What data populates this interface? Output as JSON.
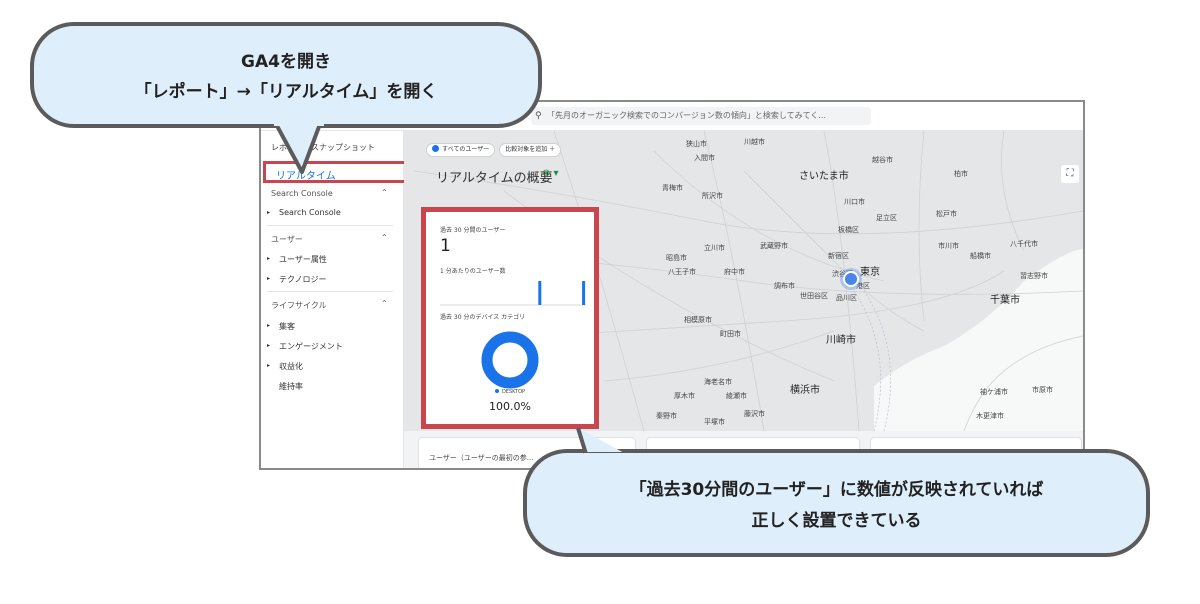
{
  "search": {
    "placeholder": "「先月のオーガニック検索でのコンバージョン数の傾向」と検索してみてく..."
  },
  "sidebar": {
    "snapshot_label": "レポートのスナップショット",
    "realtime_label": "リアルタイム",
    "sections": [
      {
        "title": "Search Console",
        "items": [
          "Search Console"
        ]
      },
      {
        "title": "ユーザー",
        "items": [
          "ユーザー属性",
          "テクノロジー"
        ]
      },
      {
        "title": "ライフサイクル",
        "items": [
          "集客",
          "エンゲージメント",
          "収益化",
          "維持率"
        ]
      }
    ]
  },
  "toolbar": {
    "all_users_chip": "すべてのユーザー",
    "add_compare_chip": "比較対象を追加 ＋"
  },
  "page": {
    "title": "リアルタイムの概要"
  },
  "card": {
    "users_label": "過去 30 分間のユーザー",
    "users_value": "1",
    "per_minute_label": "1 分あたりのユーザー数",
    "device_label": "過去 30 分のデバイス カテゴリ",
    "device_legend": "DESKTOP",
    "device_percent": "100.0%",
    "per_minute_bars": [
      0,
      0,
      0,
      0,
      0,
      0,
      0,
      0,
      0,
      0,
      0,
      0,
      0,
      0,
      0,
      0,
      0,
      0,
      0,
      0,
      1,
      0,
      0,
      0,
      0,
      0,
      0,
      0,
      0,
      1
    ]
  },
  "bottom": {
    "users_label": "ユーザー（ユーザーの最初の参..."
  },
  "map_places": [
    {
      "name": "川越市",
      "big": false
    },
    {
      "name": "越谷市",
      "big": false
    },
    {
      "name": "さいたま市",
      "big": true
    },
    {
      "name": "柏市",
      "big": false
    },
    {
      "name": "川口市",
      "big": false
    },
    {
      "name": "足立区",
      "big": false
    },
    {
      "name": "松戸市",
      "big": false
    },
    {
      "name": "板橋区",
      "big": false
    },
    {
      "name": "市川市",
      "big": false
    },
    {
      "name": "船橋市",
      "big": false
    },
    {
      "name": "八千代市",
      "big": false
    },
    {
      "name": "新宿区",
      "big": false
    },
    {
      "name": "東京",
      "big": true
    },
    {
      "name": "渋谷区",
      "big": false
    },
    {
      "name": "港区",
      "big": false
    },
    {
      "name": "世田谷区",
      "big": false
    },
    {
      "name": "品川区",
      "big": false
    },
    {
      "name": "千葉市",
      "big": true
    },
    {
      "name": "八王子市",
      "big": false
    },
    {
      "name": "府中市",
      "big": false
    },
    {
      "name": "武蔵野市",
      "big": false
    },
    {
      "name": "立川市",
      "big": false
    },
    {
      "name": "昭島市",
      "big": false
    },
    {
      "name": "調布市",
      "big": false
    },
    {
      "name": "相模原市",
      "big": false
    },
    {
      "name": "町田市",
      "big": false
    },
    {
      "name": "川崎市",
      "big": true
    },
    {
      "name": "横浜市",
      "big": true
    },
    {
      "name": "青梅市",
      "big": false
    },
    {
      "name": "入間市",
      "big": false
    },
    {
      "name": "所沢市",
      "big": false
    },
    {
      "name": "狭山市",
      "big": false
    },
    {
      "name": "海老名市",
      "big": false
    },
    {
      "name": "厚木市",
      "big": false
    },
    {
      "name": "綾瀬市",
      "big": false
    },
    {
      "name": "秦野市",
      "big": false
    },
    {
      "name": "平塚市",
      "big": false
    },
    {
      "name": "藤沢市",
      "big": false
    },
    {
      "name": "木更津市",
      "big": false
    },
    {
      "name": "袖ケ浦市",
      "big": false
    },
    {
      "name": "市原市",
      "big": false
    },
    {
      "name": "習志野市",
      "big": false
    }
  ],
  "callouts": {
    "top_line1": "GA4を開き",
    "top_line2": "「レポート」→「リアルタイム」を開く",
    "bottom_line1": "「過去30分間のユーザー」に数値が反映されていれば",
    "bottom_line2": "正しく設置できている"
  },
  "colors": {
    "highlight": "#c9464f",
    "accent": "#1a73e8",
    "bubble_fill": "#deeefb",
    "bubble_border": "#5b5b5b"
  }
}
